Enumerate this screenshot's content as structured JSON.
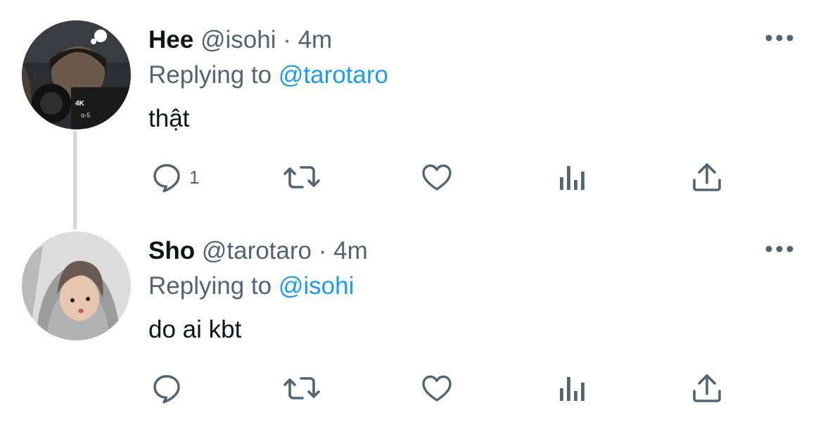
{
  "tweets": [
    {
      "name": "Hee",
      "handle": "@isohi",
      "dot": "·",
      "time": "4m",
      "replying_prefix": "Replying to",
      "replying_mention": "@tarotaro",
      "text": "thật",
      "actions": {
        "reply_count": "1",
        "retweet_count": "",
        "like_count": ""
      }
    },
    {
      "name": "Sho",
      "handle": "@tarotaro",
      "dot": "·",
      "time": "4m",
      "replying_prefix": "Replying to",
      "replying_mention": "@isohi",
      "text": "do ai kbt",
      "actions": {
        "reply_count": "",
        "retweet_count": "",
        "like_count": ""
      }
    }
  ],
  "icons": [
    "reply-icon",
    "retweet-icon",
    "like-icon",
    "analytics-icon",
    "share-icon",
    "more-icon"
  ],
  "colors": {
    "text": "#0f1419",
    "secondary": "#536471",
    "link": "#1d9bf0",
    "thread_line": "#cfd9de"
  }
}
